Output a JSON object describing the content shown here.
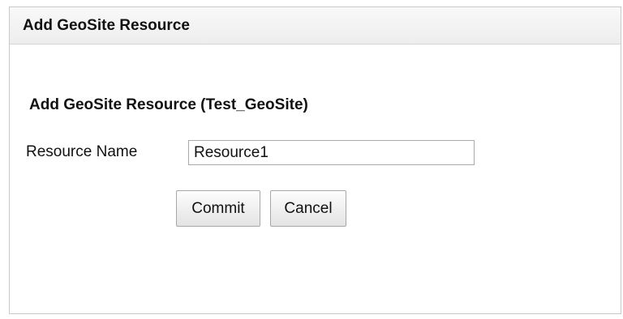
{
  "dialog": {
    "title": "Add GeoSite Resource",
    "subtitle": "Add GeoSite Resource (Test_GeoSite)",
    "resource_name_label": "Resource Name",
    "resource_name_value": "Resource1",
    "commit_label": "Commit",
    "cancel_label": "Cancel"
  }
}
